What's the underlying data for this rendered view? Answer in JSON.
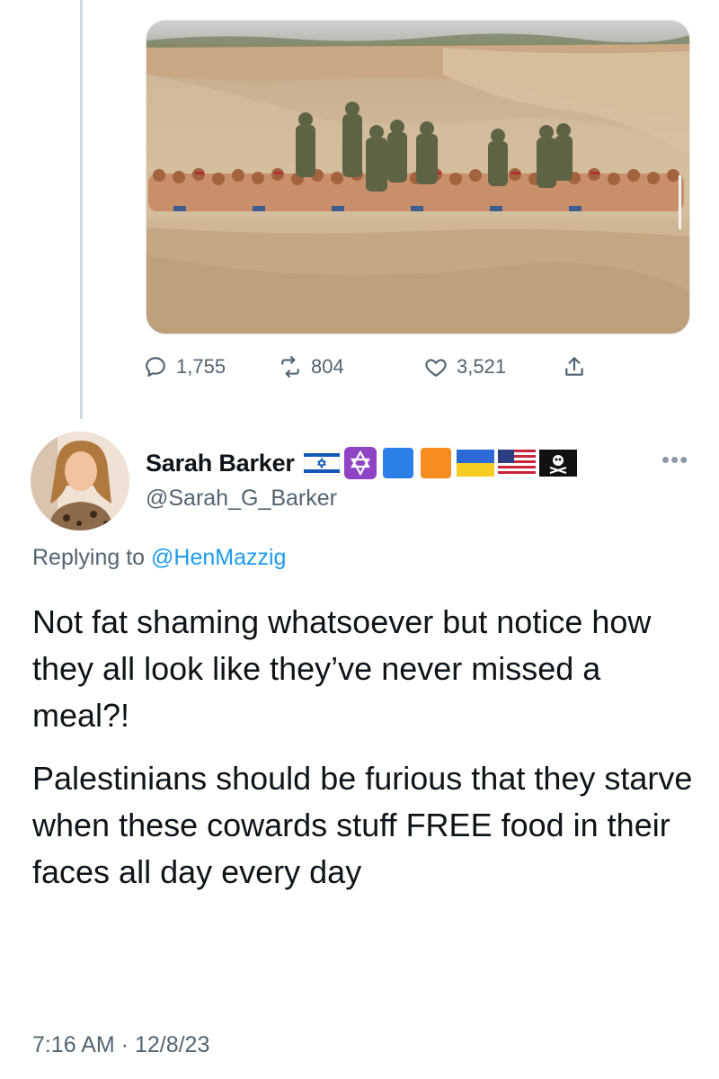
{
  "media": {
    "alt": "Photo of a group of kneeling men in a sandy field with armed soldiers standing behind them"
  },
  "stats": {
    "replies": "1,755",
    "retweets": "804",
    "likes": "3,521"
  },
  "reply": {
    "name": "Sarah Barker",
    "handle": "@Sarah_G_Barker",
    "badges": [
      "israel-flag-icon",
      "star-of-david-icon",
      "blue-square-icon",
      "orange-square-icon",
      "ukraine-flag-icon",
      "usa-flag-icon",
      "pirate-flag-icon"
    ],
    "replying_prefix": "Replying to ",
    "replying_mention": "@HenMazzig",
    "text_p1": "Not fat shaming whatsoever but notice how they all look like they’ve never missed a meal?!",
    "text_p2": "Palestinians should be furious that they starve when these cowards stuff FREE food in their faces all day every day",
    "timestamp": "7:16 AM · 12/8/23"
  },
  "colors": {
    "link": "#1d9bf0",
    "secondary_text": "#536471",
    "thread_line": "#cfd9de"
  }
}
